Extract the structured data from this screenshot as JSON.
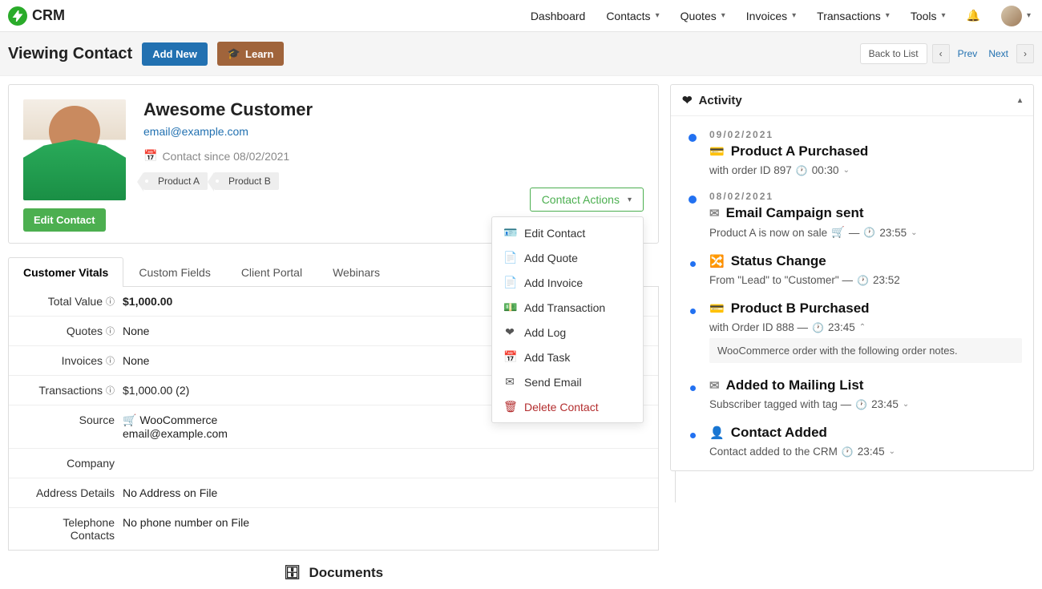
{
  "brand": {
    "name": "CRM"
  },
  "nav": {
    "dashboard": "Dashboard",
    "contacts": "Contacts",
    "quotes": "Quotes",
    "invoices": "Invoices",
    "transactions": "Transactions",
    "tools": "Tools"
  },
  "header": {
    "title": "Viewing Contact",
    "add_new": "Add New",
    "learn": "Learn",
    "back_to_list": "Back to List",
    "prev": "Prev",
    "next": "Next"
  },
  "contact": {
    "name": "Awesome Customer",
    "email": "email@example.com",
    "since_label": "Contact since 08/02/2021",
    "tags": [
      "Product A",
      "Product B"
    ],
    "edit_label": "Edit Contact",
    "actions_label": "Contact Actions",
    "actions": {
      "edit": "Edit Contact",
      "add_quote": "Add Quote",
      "add_invoice": "Add Invoice",
      "add_transaction": "Add Transaction",
      "add_log": "Add Log",
      "add_task": "Add Task",
      "send_email": "Send Email",
      "delete": "Delete Contact"
    }
  },
  "tabs": {
    "vitals": "Customer Vitals",
    "custom": "Custom Fields",
    "portal": "Client Portal",
    "webinars": "Webinars"
  },
  "vitals": {
    "total_value_label": "Total Value",
    "total_value": "$1,000.00",
    "quotes_label": "Quotes",
    "quotes": "None",
    "invoices_label": "Invoices",
    "invoices": "None",
    "transactions_label": "Transactions",
    "transactions": "$1,000.00 (2)",
    "source_label": "Source",
    "source_platform": "WooCommerce",
    "source_email": "email@example.com",
    "company_label": "Company",
    "company": "",
    "address_label": "Address Details",
    "address": "No Address on File",
    "telephone_label": "Telephone Contacts",
    "telephone": "No phone number on File"
  },
  "documents": {
    "title": "Documents"
  },
  "activity": {
    "title": "Activity",
    "items": {
      "0": {
        "date": "09/02/2021",
        "title": "Product A Purchased",
        "desc_prefix": "with order ID 897",
        "time": "00:30"
      },
      "1": {
        "date": "08/02/2021",
        "title": "Email Campaign sent",
        "desc_prefix": "Product A is now on sale",
        "time": "23:55"
      },
      "2": {
        "title": "Status Change",
        "desc_prefix": "From \"Lead\" to \"Customer\" —",
        "time": "23:52"
      },
      "3": {
        "title": "Product B Purchased",
        "desc_prefix": "with Order ID 888 —",
        "time": "23:45",
        "note": "WooCommerce order with the following order notes."
      },
      "4": {
        "title": "Added to Mailing List",
        "desc_prefix": "Subscriber tagged with tag —",
        "time": "23:45"
      },
      "5": {
        "title": "Contact Added",
        "desc_prefix": "Contact added to the CRM",
        "time": "23:45"
      }
    }
  }
}
